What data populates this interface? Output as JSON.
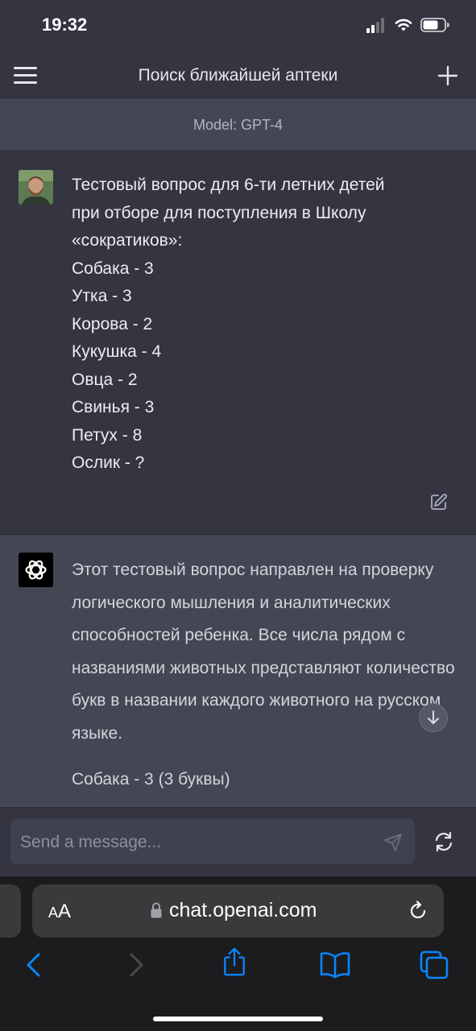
{
  "status_bar": {
    "time": "19:32"
  },
  "header": {
    "title": "Поиск ближайшей аптеки"
  },
  "model_bar": {
    "label": "Model: GPT-4"
  },
  "user_message": {
    "lines": [
      "Тестовый вопрос для 6-ти летних детей",
      "при отборе для поступления в Школу",
      "«сократиков»:",
      "Собака - 3",
      "Утка - 3",
      "Корова - 2",
      "Кукушка - 4",
      "Овца - 2",
      "Свинья - 3",
      "Петух - 8",
      "Ослик - ?"
    ]
  },
  "assistant_message": {
    "paragraph": "Этот тестовый вопрос направлен на проверку логического мышления и аналитических способностей ребенка. Все числа рядом с названиями животных представляют количество букв в названии каждого животного на русском языке.",
    "line2": "Собака - 3 (3 буквы)"
  },
  "composer": {
    "placeholder": "Send a message..."
  },
  "browser": {
    "aa_label_small": "A",
    "aa_label_large": "A",
    "url": "chat.openai.com"
  },
  "colors": {
    "background": "#343541",
    "assistant_bg": "#444654",
    "safari_accent": "#0a84ff"
  }
}
